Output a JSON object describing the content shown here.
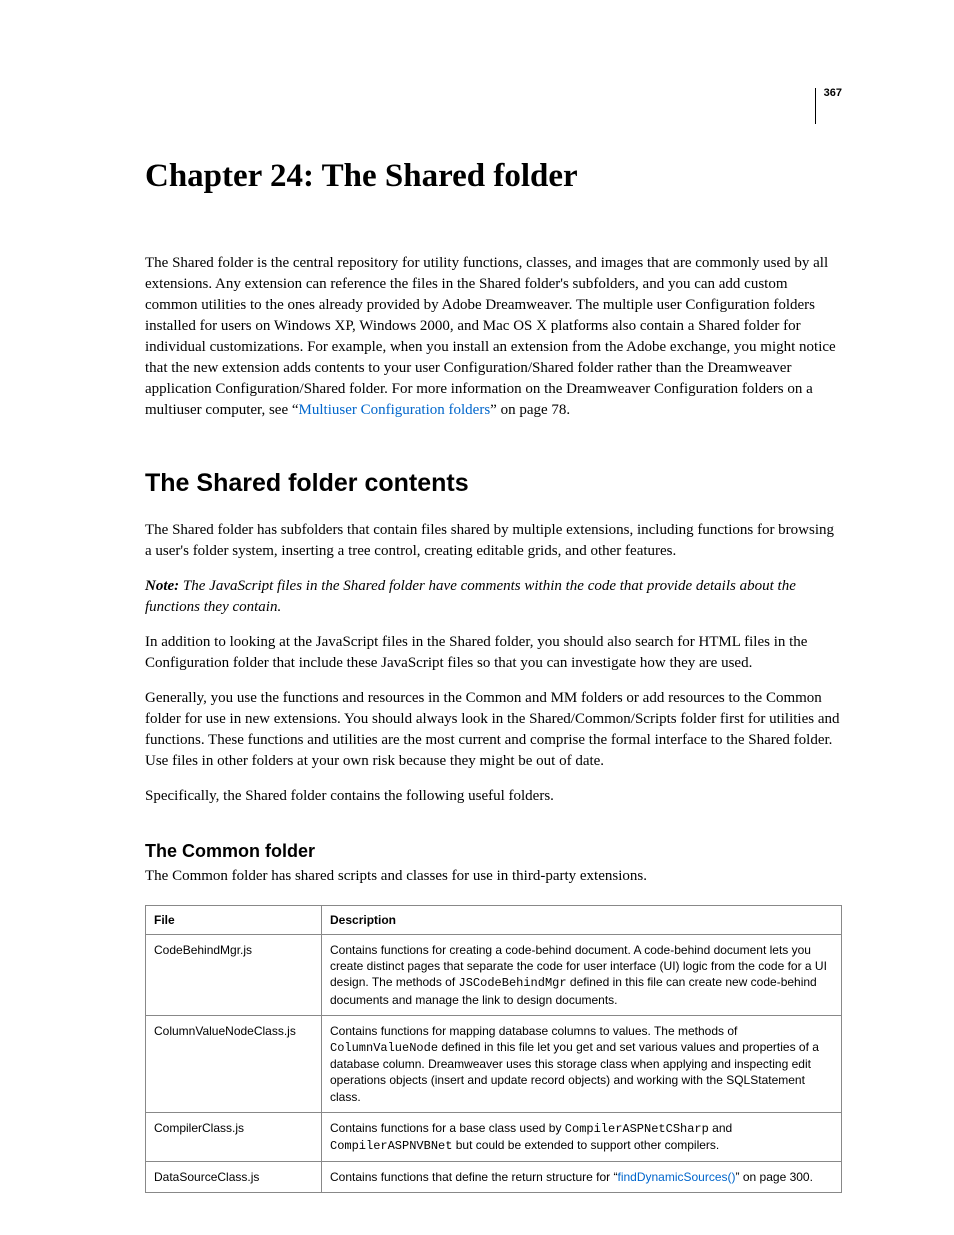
{
  "page_number": "367",
  "chapter_title": "Chapter 24: The Shared folder",
  "intro": {
    "pre": "The Shared folder is the central repository for utility functions, classes, and images that are commonly used by all extensions. Any extension can reference the files in the Shared folder's subfolders, and you can add custom common utilities to the ones already provided by Adobe Dreamweaver. The multiple user Configuration folders installed for users on Windows XP, Windows 2000, and Mac OS X platforms also contain a Shared folder for individual customizations. For example, when you install an extension from the Adobe exchange, you might notice that the new extension adds contents to your user Configuration/Shared folder rather than the Dreamweaver application Configuration/Shared folder. For more information on the Dreamweaver Configuration folders on a multiuser computer, see “",
    "link": "Multiuser Configuration folders",
    "post": "” on page 78."
  },
  "section": {
    "title": "The Shared folder contents",
    "p1": "The Shared folder has subfolders that contain files shared by multiple extensions, including functions for browsing a user's folder system, inserting a tree control, creating editable grids, and other features.",
    "note_label": "Note:",
    "note_body": " The JavaScript files in the Shared folder have comments within the code that provide details about the functions they contain.",
    "p2": "In addition to looking at the JavaScript files in the Shared folder, you should also search for HTML files in the Configuration folder that include these JavaScript files so that you can investigate how they are used.",
    "p3": "Generally, you use the functions and resources in the Common and MM folders or add resources to the Common folder for use in new extensions. You should always look in the Shared/Common/Scripts folder first for utilities and functions. These functions and utilities are the most current and comprise the formal interface to the Shared folder. Use files in other folders at your own risk because they might be out of date.",
    "p4": "Specifically, the Shared folder contains the following useful folders."
  },
  "subsection": {
    "title": "The Common folder",
    "intro": "The Common folder has shared scripts and classes for use in third-party extensions."
  },
  "table": {
    "headers": {
      "file": "File",
      "desc": "Description"
    },
    "rows": {
      "r0": {
        "file": "CodeBehindMgr.js",
        "d_pre": "Contains functions for creating a code-behind document. A code-behind document lets you create distinct pages that separate the code for user interface (UI) logic from the code for a UI design. The methods of ",
        "code1": "JSCodeBehindMgr",
        "d_post": " defined in this file can create new code-behind documents and manage the link to design documents."
      },
      "r1": {
        "file": "ColumnValueNodeClass.js",
        "d_pre": "Contains functions for mapping database columns to values. The methods of ",
        "code1": "ColumnValueNode",
        "d_post": " defined in this file let you get and set various values and properties of a database column. Dreamweaver uses this storage class when applying and inspecting edit operations objects (insert and update record objects) and working with the SQLStatement class."
      },
      "r2": {
        "file": "CompilerClass.js",
        "d_pre": "Contains functions for a base class used by ",
        "code1": "CompilerASPNetCSharp",
        "mid": " and ",
        "code2": "CompilerASPNVBNet",
        "d_post": " but could be extended to support other compilers."
      },
      "r3": {
        "file": "DataSourceClass.js",
        "d_pre": "Contains functions that define the return structure for “",
        "link": "findDynamicSources()",
        "d_post": "” on page 300."
      }
    }
  }
}
